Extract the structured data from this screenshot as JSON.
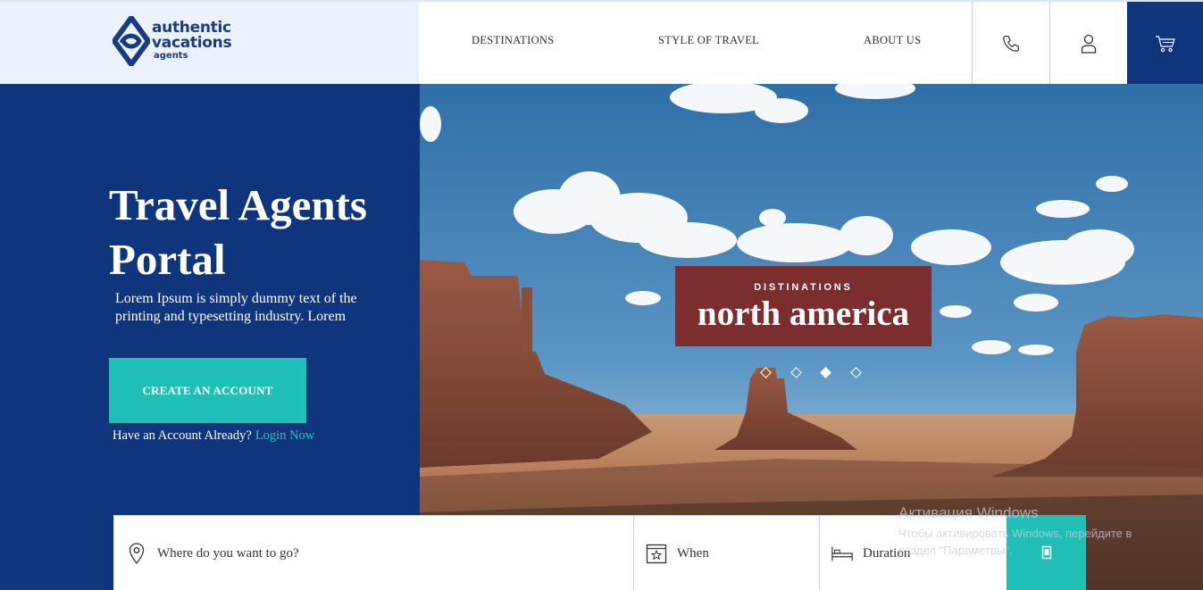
{
  "logo": {
    "line1": "authentic",
    "line2": "vacations",
    "line3": "agents"
  },
  "nav": {
    "items": [
      {
        "label": "DESTINATIONS"
      },
      {
        "label": "STYLE OF TRAVEL"
      },
      {
        "label": "ABOUT US"
      }
    ]
  },
  "header_icons": {
    "phone": "phone-icon",
    "user": "user-icon",
    "cart": "cart-icon"
  },
  "hero": {
    "title_line1": "Travel Agents",
    "title_line2": "Portal",
    "description": "Lorem Ipsum is simply dummy text of the printing and typesetting industry. Lorem",
    "cta_label": "CREATE AN ACCOUNT",
    "login_prompt": "Have an Account Already?",
    "login_link": "Login Now"
  },
  "slide": {
    "kicker": "DISTINATIONS",
    "name": "north america",
    "dots_count": 4,
    "active_dot": 3
  },
  "search": {
    "where_placeholder": "Where do you want to go?",
    "when_label": "When",
    "duration_label": "Duration"
  },
  "watermark": {
    "line1": "Активация Windows",
    "line2": "Чтобы активировать Windows, перейдите в",
    "line3": "раздел \"Параметры\"."
  },
  "colors": {
    "navy": "#0f357d",
    "teal": "#1fbfb8",
    "maroon": "#7c2e2e",
    "logo_bg": "#eaf3fd"
  }
}
